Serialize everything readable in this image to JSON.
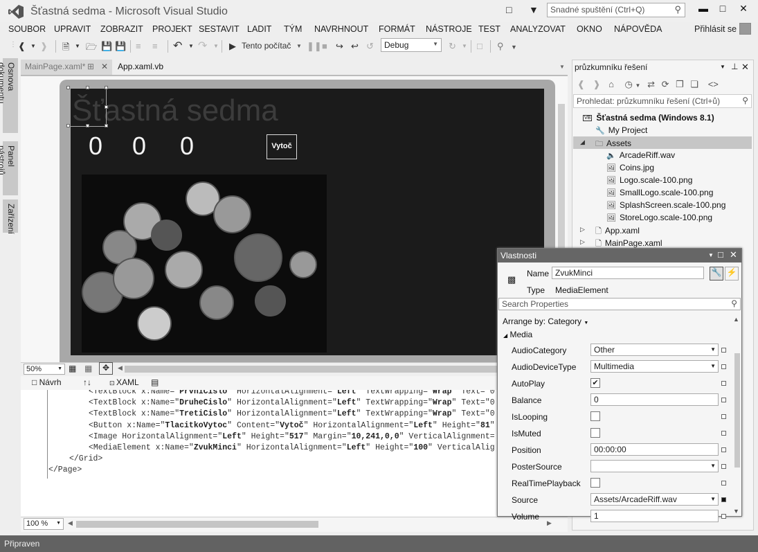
{
  "window": {
    "title": "Šťastná sedma - Microsoft Visual Studio",
    "quick_launch_placeholder": "Snadné spuštění (Ctrl+Q)",
    "sign_in": "Přihlásit se"
  },
  "menu": [
    "SOUBOR",
    "UPRAVIT",
    "ZOBRAZIT",
    "PROJEKT",
    "SESTAVIT",
    "LADIT",
    "TÝM",
    "NAVRHNOUT",
    "FORMÁT",
    "NÁSTROJE",
    "TEST",
    "ANALYZOVAT",
    "OKNO",
    "NÁPOVĚDA"
  ],
  "toolbar": {
    "run_target": "Tento počítač",
    "configuration": "Debug"
  },
  "left_tabs": [
    "Osnova dokumentu",
    "Panel nástrojů",
    "Zařízení"
  ],
  "doc_tabs": [
    {
      "label": "MainPage.xaml*",
      "active": false
    },
    {
      "label": "App.xaml.vb",
      "active": true
    }
  ],
  "designer": {
    "app_title": "Šťastná sedma",
    "digits": [
      "0",
      "0",
      "0"
    ],
    "button_label": "Vytoč",
    "zoom": "50%"
  },
  "split_tabs": {
    "design": "Návrh",
    "swap": "↑↓",
    "xaml": "XAML"
  },
  "xaml_lines": [
    {
      "indent": 2,
      "parts": [
        [
          "<TextBlock x:Name=\"",
          0
        ],
        [
          "PrvniCislo",
          1
        ],
        [
          "\" HorizontalAlignment=\"",
          0
        ],
        [
          "Left",
          1
        ],
        [
          "\" TextWrapping=\"",
          0
        ],
        [
          "Wrap",
          1
        ],
        [
          "\" Text=\"0",
          0
        ]
      ]
    },
    {
      "indent": 2,
      "parts": [
        [
          "<TextBlock x:Name=\"",
          0
        ],
        [
          "DruheCislo",
          1
        ],
        [
          "\" HorizontalAlignment=\"",
          0
        ],
        [
          "Left",
          1
        ],
        [
          "\" TextWrapping=\"",
          0
        ],
        [
          "Wrap",
          1
        ],
        [
          "\" Text=\"0",
          0
        ]
      ]
    },
    {
      "indent": 2,
      "parts": [
        [
          "<TextBlock x:Name=\"",
          0
        ],
        [
          "TretiCislo",
          1
        ],
        [
          "\" HorizontalAlignment=\"",
          0
        ],
        [
          "Left",
          1
        ],
        [
          "\" TextWrapping=\"",
          0
        ],
        [
          "Wrap",
          1
        ],
        [
          "\" Text=\"0",
          0
        ]
      ]
    },
    {
      "indent": 2,
      "parts": [
        [
          "<Button x:Name=\"",
          0
        ],
        [
          "TlacitkoVytoc",
          1
        ],
        [
          "\" Content=\"",
          0
        ],
        [
          "Vytoč",
          1
        ],
        [
          "\" HorizontalAlignment=\"",
          0
        ],
        [
          "Left",
          1
        ],
        [
          "\" Height=\"",
          0
        ],
        [
          "81",
          1
        ],
        [
          "\"",
          0
        ]
      ]
    },
    {
      "indent": 2,
      "parts": [
        [
          "<Image HorizontalAlignment=\"",
          0
        ],
        [
          "Left",
          1
        ],
        [
          "\" Height=\"",
          0
        ],
        [
          "517",
          1
        ],
        [
          "\" Margin=\"",
          0
        ],
        [
          "10,241,0,0",
          1
        ],
        [
          "\" VerticalAlignment=",
          0
        ]
      ]
    },
    {
      "indent": 2,
      "parts": [
        [
          "<MediaElement x:Name=\"",
          0
        ],
        [
          "ZvukMinci",
          1
        ],
        [
          "\" HorizontalAlignment=\"",
          0
        ],
        [
          "Left",
          1
        ],
        [
          "\" Height=\"",
          0
        ],
        [
          "100",
          1
        ],
        [
          "\" VerticalAlig",
          0
        ]
      ]
    },
    {
      "indent": 1,
      "parts": [
        [
          "</Grid>",
          0
        ]
      ]
    },
    {
      "indent": 0,
      "parts": [
        [
          "</Page>",
          0
        ]
      ]
    }
  ],
  "editor_zoom": "100 %",
  "status": "Připraven",
  "solution_explorer": {
    "title": "průzkumníku řešení",
    "search_placeholder": "Prohledat: průzkumníku řešení (Ctrl+ů)",
    "items": [
      {
        "label": "Šťastná sedma (Windows 8.1)",
        "icon": "vb-project-icon",
        "level": 0,
        "bold": true
      },
      {
        "label": "My Project",
        "icon": "wrench-icon",
        "level": 1
      },
      {
        "label": "Assets",
        "icon": "folder-icon",
        "level": 1,
        "expanded": true,
        "selected": true
      },
      {
        "label": "ArcadeRiff.wav",
        "icon": "audio-file-icon",
        "level": 2
      },
      {
        "label": "Coins.jpg",
        "icon": "image-file-icon",
        "level": 2
      },
      {
        "label": "Logo.scale-100.png",
        "icon": "image-file-icon",
        "level": 2
      },
      {
        "label": "SmallLogo.scale-100.png",
        "icon": "image-file-icon",
        "level": 2
      },
      {
        "label": "SplashScreen.scale-100.png",
        "icon": "image-file-icon",
        "level": 2
      },
      {
        "label": "StoreLogo.scale-100.png",
        "icon": "image-file-icon",
        "level": 2
      },
      {
        "label": "App.xaml",
        "icon": "xaml-file-icon",
        "level": 1,
        "collapsed": true
      },
      {
        "label": "MainPage.xaml",
        "icon": "xaml-file-icon",
        "level": 1,
        "collapsed": true
      }
    ]
  },
  "properties": {
    "title": "Vlastnosti",
    "name_label": "Name",
    "name_value": "ZvukMinci",
    "type_label": "Type",
    "type_value": "MediaElement",
    "search_placeholder": "Search Properties",
    "arrange_by": "Arrange by: Category",
    "category": "Media",
    "rows": [
      {
        "label": "AudioCategory",
        "kind": "select",
        "value": "Other"
      },
      {
        "label": "AudioDeviceType",
        "kind": "select",
        "value": "Multimedia"
      },
      {
        "label": "AutoPlay",
        "kind": "check",
        "value": true
      },
      {
        "label": "Balance",
        "kind": "text",
        "value": "0"
      },
      {
        "label": "IsLooping",
        "kind": "check",
        "value": false
      },
      {
        "label": "IsMuted",
        "kind": "check",
        "value": false
      },
      {
        "label": "Position",
        "kind": "text",
        "value": "00:00:00"
      },
      {
        "label": "PosterSource",
        "kind": "select",
        "value": ""
      },
      {
        "label": "RealTimePlayback",
        "kind": "check",
        "value": false
      },
      {
        "label": "Source",
        "kind": "select",
        "value": "Assets/ArcadeRiff.wav",
        "set": true
      },
      {
        "label": "Volume",
        "kind": "text",
        "value": "1"
      }
    ]
  }
}
